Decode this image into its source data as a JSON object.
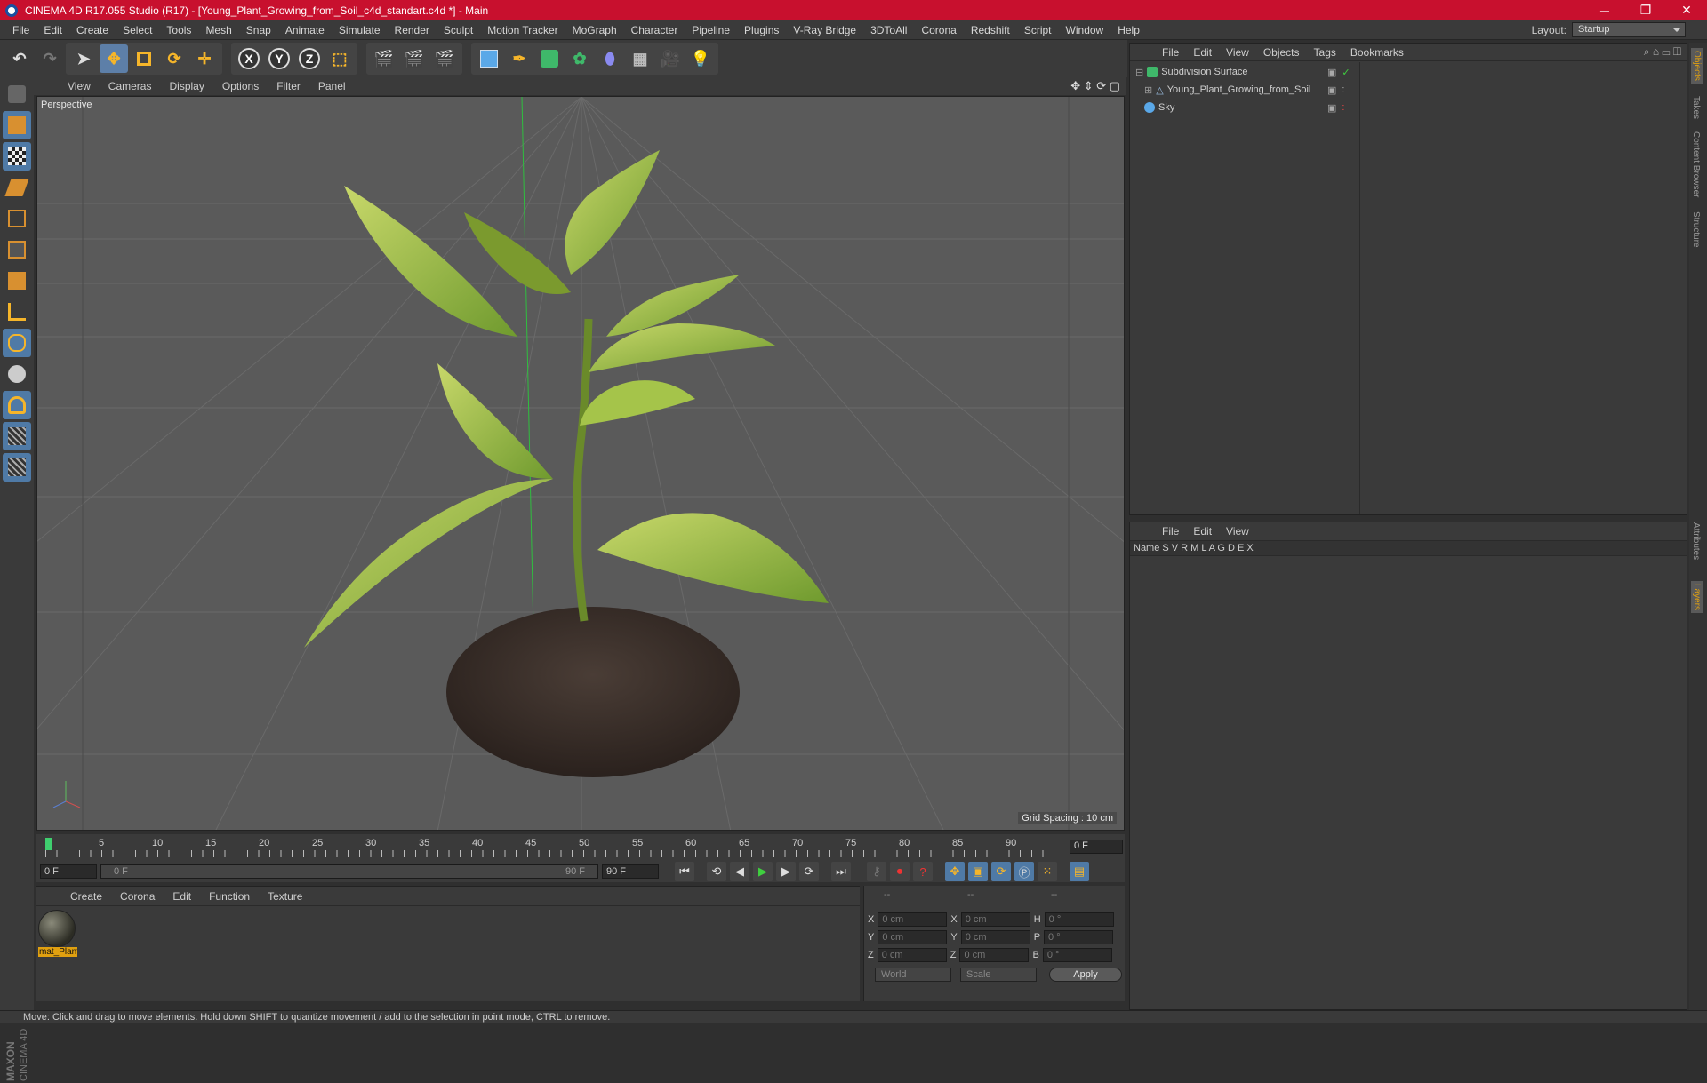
{
  "window": {
    "title": "CINEMA 4D R17.055 Studio (R17) - [Young_Plant_Growing_from_Soil_c4d_standart.c4d *] - Main",
    "minimize": "─",
    "maximize": "❐",
    "close": "✕"
  },
  "menu": [
    "File",
    "Edit",
    "Create",
    "Select",
    "Tools",
    "Mesh",
    "Snap",
    "Animate",
    "Simulate",
    "Render",
    "Sculpt",
    "Motion Tracker",
    "MoGraph",
    "Character",
    "Pipeline",
    "Plugins",
    "V-Ray Bridge",
    "3DToAll",
    "Corona",
    "Redshift",
    "Script",
    "Window",
    "Help"
  ],
  "layout": {
    "label": "Layout:",
    "value": "Startup"
  },
  "toolbar": {
    "axes": [
      "X",
      "Y",
      "Z"
    ]
  },
  "viewport": {
    "menu": [
      "View",
      "Cameras",
      "Display",
      "Options",
      "Filter",
      "Panel"
    ],
    "name": "Perspective",
    "grid_spacing": "Grid Spacing : 10 cm"
  },
  "timeline": {
    "ticks": [
      "0",
      "5",
      "10",
      "15",
      "20",
      "25",
      "30",
      "35",
      "40",
      "45",
      "50",
      "55",
      "60",
      "65",
      "70",
      "75",
      "80",
      "85",
      "90"
    ],
    "current_frame": "0 F"
  },
  "transport": {
    "start": "0 F",
    "range_start": "0 F",
    "range_end": "90 F",
    "end": "90 F"
  },
  "material_manager": {
    "menu": [
      "Create",
      "Corona",
      "Edit",
      "Function",
      "Texture"
    ],
    "material_name": "mat_Plant"
  },
  "coords": {
    "headers": [
      "--",
      "--",
      "--"
    ],
    "rows": [
      {
        "a": "X",
        "v1": "0 cm",
        "b": "X",
        "v2": "0 cm",
        "c": "H",
        "v3": "0 °"
      },
      {
        "a": "Y",
        "v1": "0 cm",
        "b": "Y",
        "v2": "0 cm",
        "c": "P",
        "v3": "0 °"
      },
      {
        "a": "Z",
        "v1": "0 cm",
        "b": "Z",
        "v2": "0 cm",
        "c": "B",
        "v3": "0 °"
      }
    ],
    "mode": "World",
    "scale": "Scale",
    "apply": "Apply"
  },
  "object_manager": {
    "menu": [
      "File",
      "Edit",
      "View",
      "Objects",
      "Tags",
      "Bookmarks"
    ],
    "objects": [
      {
        "name": "Subdivision Surface"
      },
      {
        "name": "Young_Plant_Growing_from_Soil"
      },
      {
        "name": "Sky"
      }
    ]
  },
  "attribute_manager": {
    "menu": [
      "File",
      "Edit",
      "View"
    ],
    "columns": "Name  S V R M L A G D E X"
  },
  "right_tabs": [
    "Objects",
    "Takes",
    "Content Browser",
    "Structure",
    "Attributes",
    "Layers"
  ],
  "status": "Move: Click and drag to move elements. Hold down SHIFT to quantize movement / add to the selection in point mode, CTRL to remove.",
  "brand": "MAXON CINEMA 4D",
  "colors": {
    "title_bar": "#c8102e",
    "tool_active": "#4f7aa6",
    "material_label": "#e0a010",
    "viewport_bg": "#5a5a5a"
  }
}
